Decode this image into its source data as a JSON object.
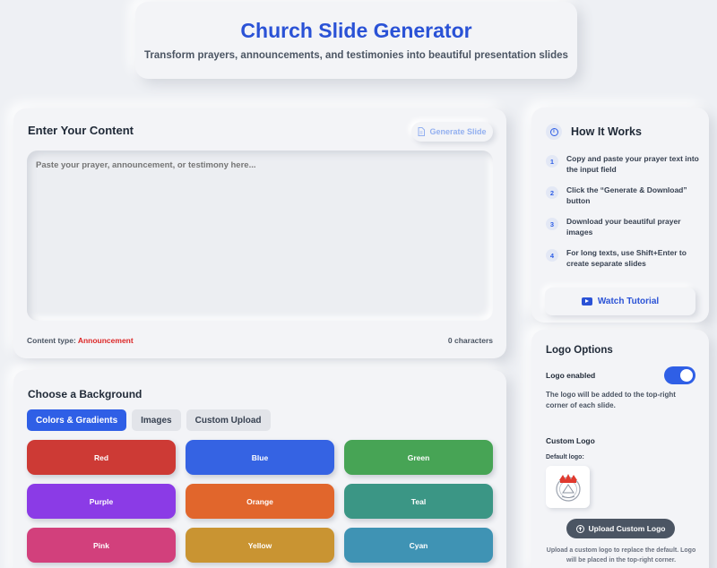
{
  "header": {
    "title": "Church Slide Generator",
    "subtitle": "Transform prayers, announcements, and testimonies into beautiful presentation slides"
  },
  "content": {
    "title": "Enter Your Content",
    "generate_label": "Generate Slide",
    "textarea_placeholder": "Paste your prayer, announcement, or testimony here...",
    "content_type_label": "Content type:",
    "content_type_value": "Announcement",
    "char_count": "0 characters"
  },
  "background": {
    "title": "Choose a Background",
    "tabs": [
      {
        "label": "Colors & Gradients",
        "active": true
      },
      {
        "label": "Images",
        "active": false
      },
      {
        "label": "Custom Upload",
        "active": false
      }
    ],
    "swatches": [
      {
        "label": "Red",
        "color": "#cd3a35"
      },
      {
        "label": "Blue",
        "color": "#3563e3"
      },
      {
        "label": "Green",
        "color": "#47a455"
      },
      {
        "label": "Purple",
        "color": "#8b3be6"
      },
      {
        "label": "Orange",
        "color": "#e1662c"
      },
      {
        "label": "Teal",
        "color": "#3b9685"
      },
      {
        "label": "Pink",
        "color": "#d2407c"
      },
      {
        "label": "Yellow",
        "color": "#c99432"
      },
      {
        "label": "Cyan",
        "color": "#3f93b4"
      }
    ]
  },
  "how_it_works": {
    "title": "How It Works",
    "steps": [
      {
        "num": "1",
        "text": "Copy and paste your prayer text into the input field"
      },
      {
        "num": "2",
        "text": "Click the “Generate & Download” button"
      },
      {
        "num": "3",
        "text": "Download your beautiful prayer images"
      },
      {
        "num": "4",
        "text": "For long texts, use Shift+Enter to create separate slides"
      }
    ],
    "watch_label": "Watch Tutorial"
  },
  "logo": {
    "title": "Logo Options",
    "enabled_label": "Logo enabled",
    "enabled": true,
    "description": "The logo will be added to the top-right corner of each slide.",
    "custom_label": "Custom Logo",
    "default_label": "Default logo:",
    "upload_label": "Upload Custom Logo",
    "upload_desc": "Upload a custom logo to replace the default. Logo will be placed in the top-right corner."
  },
  "colors": {
    "accent": "#2f5fe6",
    "title": "#2a52d6",
    "content_type": "#dc2626"
  }
}
